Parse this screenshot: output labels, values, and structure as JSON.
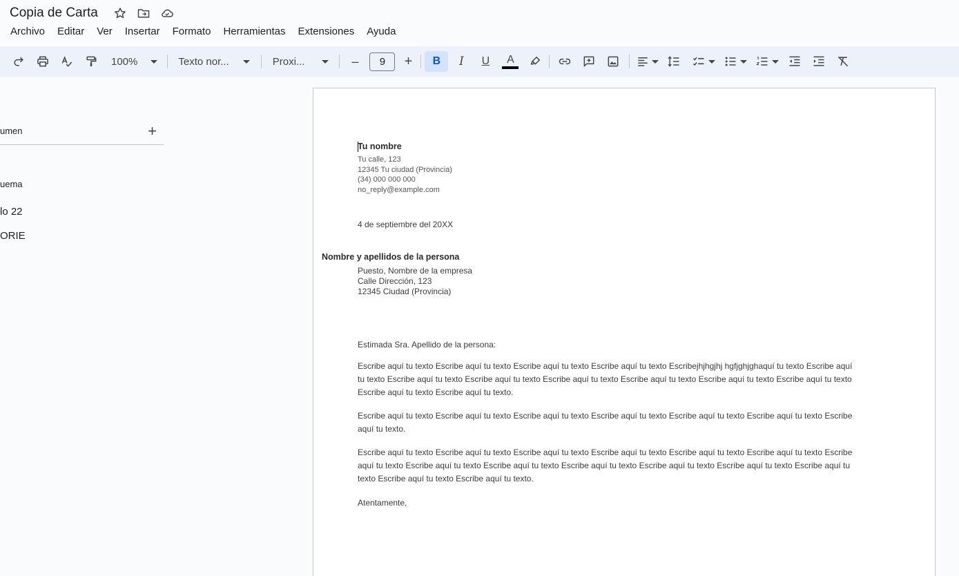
{
  "app": {
    "doc_title": "Copia de Carta"
  },
  "menu": [
    "Archivo",
    "Editar",
    "Ver",
    "Insertar",
    "Formato",
    "Herramientas",
    "Extensiones",
    "Ayuda"
  ],
  "toolbar": {
    "zoom": "100%",
    "style": "Texto nor...",
    "font": "Proxi...",
    "font_size": "9",
    "minus": "–",
    "plus": "+",
    "bold": "B",
    "italic": "I",
    "underline": "U",
    "text_color": "A",
    "text_color_bar": "#000000",
    "active_bg": "#d3e3fd"
  },
  "outline": {
    "header_label": "umen",
    "add_symbol": "+",
    "sub_label": "uema",
    "entries": [
      "lo 22",
      "ORIE"
    ]
  },
  "document": {
    "sender": {
      "name": "Tu nombre",
      "street": "Tu calle, 123",
      "city": "12345 Tu ciudad (Provincia)",
      "phone": "(34) 000 000 000",
      "email": "no_reply@example.com"
    },
    "date": "4 de septiembre del 20XX",
    "recipient": {
      "name": "Nombre y apellidos de la persona",
      "position": "Puesto, Nombre de la empresa",
      "street": "Calle Dirección, 123",
      "city": "12345 Ciudad (Provincia)"
    },
    "greeting": "Estimada Sra. Apellido de la persona:",
    "paragraphs": [
      "Escribe aquí tu texto Escribe aquí tu texto Escribe aquí tu texto Escribe aquí tu texto Escribejhjhgjhj hgfjghjghaquí tu texto Escribe aquí tu texto Escribe aquí tu texto Escribe aquí tu texto Escribe aquí tu texto Escribe aquí tu texto Escribe aquí tu texto Escribe aquí tu texto Escribe aquí tu texto Escribe aquí tu texto.",
      "Escribe aquí tu texto Escribe aquí tu texto Escribe aquí tu texto Escribe aquí tu texto Escribe aquí tu texto Escribe aquí tu texto Escribe aquí tu texto.",
      "Escribe aquí tu texto Escribe aquí tu texto Escribe aquí tu texto Escribe aquí tu texto Escribe aquí tu texto Escribe aquí tu texto Escribe aquí tu texto Escribe aquí tu texto Escribe aquí tu texto Escribe aquí tu texto Escribe aquí tu texto Escribe aquí tu texto Escribe aquí tu texto Escribe aquí tu texto Escribe aquí tu texto."
    ],
    "closing": "Atentamente,"
  }
}
